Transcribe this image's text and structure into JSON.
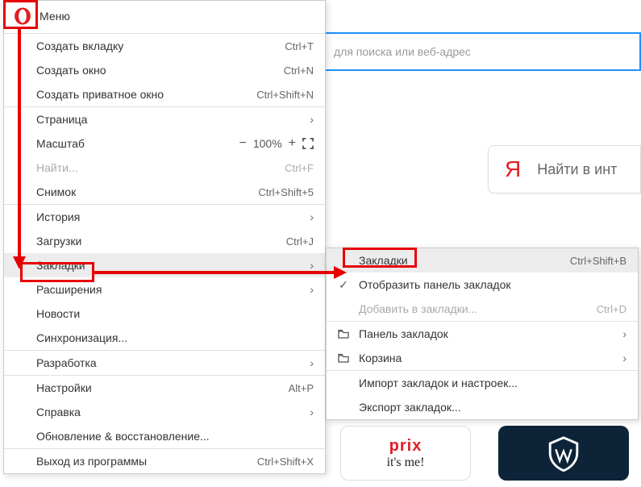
{
  "searchbar": {
    "placeholder": "для поиска или веб-адрес"
  },
  "yandex": {
    "letter": "Я",
    "label": "Найти в инт"
  },
  "menu": {
    "title": "Меню",
    "items": {
      "new_tab": {
        "label": "Создать вкладку",
        "shortcut": "Ctrl+T"
      },
      "new_window": {
        "label": "Создать окно",
        "shortcut": "Ctrl+N"
      },
      "new_private": {
        "label": "Создать приватное окно",
        "shortcut": "Ctrl+Shift+N"
      },
      "page": {
        "label": "Страница"
      },
      "zoom": {
        "label": "Масштаб",
        "value": "100%"
      },
      "find": {
        "label": "Найти...",
        "shortcut": "Ctrl+F"
      },
      "snapshot": {
        "label": "Снимок",
        "shortcut": "Ctrl+Shift+5"
      },
      "history": {
        "label": "История"
      },
      "downloads": {
        "label": "Загрузки",
        "shortcut": "Ctrl+J"
      },
      "bookmarks": {
        "label": "Закладки"
      },
      "extensions": {
        "label": "Расширения"
      },
      "news": {
        "label": "Новости"
      },
      "sync": {
        "label": "Синхронизация..."
      },
      "dev": {
        "label": "Разработка"
      },
      "settings": {
        "label": "Настройки",
        "shortcut": "Alt+P"
      },
      "help": {
        "label": "Справка"
      },
      "update": {
        "label": "Обновление & восстановление..."
      },
      "exit": {
        "label": "Выход из программы",
        "shortcut": "Ctrl+Shift+X"
      }
    }
  },
  "submenu": {
    "bookmarks": {
      "label": "Закладки",
      "shortcut": "Ctrl+Shift+B"
    },
    "show_bar": {
      "label": "Отобразить панель закладок"
    },
    "add": {
      "label": "Добавить в закладки...",
      "shortcut": "Ctrl+D"
    },
    "bar": {
      "label": "Панель закладок"
    },
    "trash": {
      "label": "Корзина"
    },
    "import": {
      "label": "Импорт закладок и настроек..."
    },
    "export": {
      "label": "Экспорт закладок..."
    }
  },
  "tiles": {
    "prix1": "prix",
    "prix2": "it's me!"
  }
}
